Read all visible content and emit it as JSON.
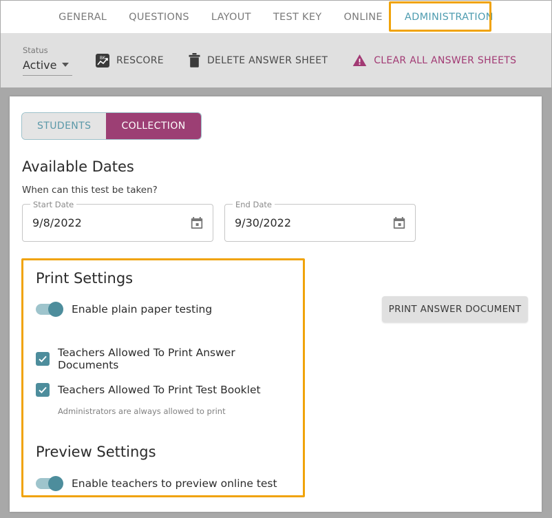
{
  "tabs": [
    {
      "label": "GENERAL",
      "active": false
    },
    {
      "label": "QUESTIONS",
      "active": false
    },
    {
      "label": "LAYOUT",
      "active": false
    },
    {
      "label": "TEST KEY",
      "active": false
    },
    {
      "label": "ONLINE",
      "active": false
    },
    {
      "label": "ADMINISTRATION",
      "active": true
    }
  ],
  "toolbar": {
    "status_label": "Status",
    "status_value": "Active",
    "rescore_label": "RESCORE",
    "delete_label": "DELETE ANSWER SHEET",
    "clear_label": "CLEAR ALL ANSWER SHEETS"
  },
  "segmented": {
    "students_label": "STUDENTS",
    "collection_label": "COLLECTION"
  },
  "available_dates": {
    "heading": "Available Dates",
    "subtitle": "When can this test be taken?",
    "start_label": "Start Date",
    "start_value": "9/8/2022",
    "end_label": "End Date",
    "end_value": "9/30/2022"
  },
  "print_settings": {
    "heading": "Print Settings",
    "plain_paper_label": "Enable plain paper testing",
    "check_answer_docs_label": "Teachers Allowed To Print Answer Documents",
    "check_test_booklet_label": "Teachers Allowed To Print Test Booklet",
    "helper": "Administrators are always allowed to print"
  },
  "preview_settings": {
    "heading": "Preview Settings",
    "preview_toggle_label": "Enable teachers to preview online test"
  },
  "actions": {
    "print_answer_document": "PRINT ANSWER DOCUMENT"
  },
  "colors": {
    "highlight": "#f0a30a",
    "accent_teal": "#4d8d9c",
    "accent_magenta": "#9c3f74",
    "tab_active": "#4e9cb0"
  }
}
